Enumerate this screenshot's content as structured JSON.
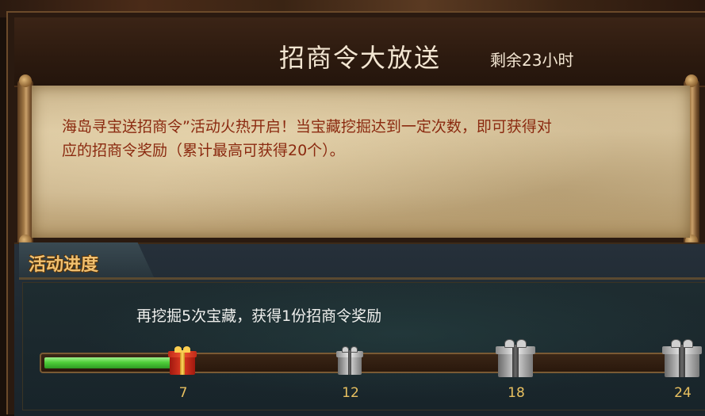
{
  "header": {
    "title": "招商令大放送",
    "timer": "剩余23小时"
  },
  "scroll": {
    "line1": "海岛寻宝送招商令”活动火热开启！当宝藏挖掘达到一定次数，即可获得对",
    "line2": "应的招商令奖励（累计最高可获得20个）。"
  },
  "progress": {
    "tab_label": "活动进度",
    "hint": "再挖掘5次宝藏，获得1份招商令奖励",
    "current": 7,
    "max": 24,
    "fill_color": "#4fcf3a",
    "milestones": [
      {
        "label": "7",
        "icon": "gift-red-icon",
        "state": "reached"
      },
      {
        "label": "12",
        "icon": "gift-grey-icon",
        "state": "locked"
      },
      {
        "label": "18",
        "icon": "gift-grey-icon",
        "state": "locked"
      },
      {
        "label": "24",
        "icon": "gift-grey-icon",
        "state": "locked"
      }
    ]
  },
  "colors": {
    "scroll_text": "#8b2a10",
    "tab_label": "#f0c070",
    "milestone_label": "#e8c060"
  }
}
